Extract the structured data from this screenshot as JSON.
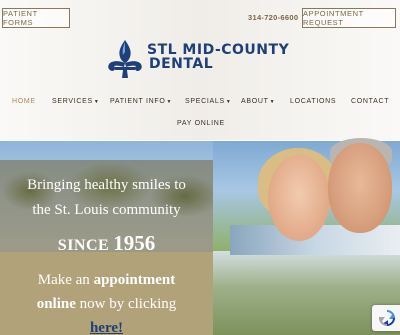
{
  "header": {
    "patient_forms_label": "PATIENT FORMS",
    "phone": "314-720-6600",
    "appointment_label": "APPOINTMENT REQUEST",
    "logo_line1": "STL Mid-County",
    "logo_line2": "Dental"
  },
  "nav": {
    "items": [
      {
        "label": "HOME"
      },
      {
        "label": "SERVICES"
      },
      {
        "label": "PATIENT INFO"
      },
      {
        "label": "SPECIALS"
      },
      {
        "label": "ABOUT"
      },
      {
        "label": "LOCATIONS"
      },
      {
        "label": "CONTACT"
      }
    ],
    "pay_online": "PAY ONLINE"
  },
  "hero": {
    "tagline_line1": "Bringing healthy smiles to",
    "tagline_line2": "the St. Louis community",
    "since_word": "SINCE",
    "since_year": "1956",
    "cta_line1_prefix": "Make an ",
    "cta_line1_bold": "appointment",
    "cta_line2_bold": "online",
    "cta_line2_suffix": " now by clicking",
    "cta_link": "here!"
  },
  "colors": {
    "brand_navy": "#1e3f78",
    "accent_gold": "#8a7658",
    "overlay_tan": "#b2a27a"
  },
  "icons": {
    "logo": "fleur-de-lis-icon",
    "caret": "chevron-down-icon",
    "recaptcha": "recaptcha-icon"
  }
}
